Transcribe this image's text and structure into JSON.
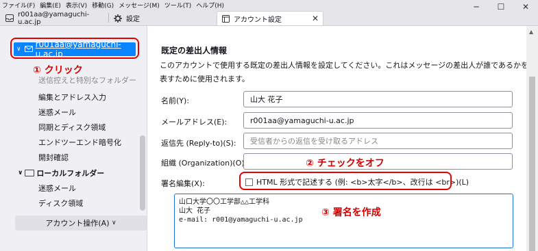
{
  "menu": [
    "ファイル(F)",
    "編集(E)",
    "表示(V)",
    "移動(G)",
    "メッセージ(M)",
    "ツール(T)",
    "ヘルプ(H)"
  ],
  "window_controls": {
    "minimize": "─",
    "maximize": "☐",
    "close": "✕"
  },
  "tabs": [
    {
      "label": "r001aa@yamaguchi-u.ac.jp",
      "icon": "inbox-icon"
    },
    {
      "label": "設定",
      "icon": "gear-icon"
    },
    {
      "label": "アカウント設定",
      "icon": "account-settings-icon",
      "active": true
    }
  ],
  "sidebar": {
    "account": "r001aa@yamaguchi-u.ac.jp",
    "items": [
      "送信控えと特別なフォルダー",
      "編集とアドレス入力",
      "迷惑メール",
      "同期とディスク領域",
      "エンドツーエンド暗号化",
      "開封確認"
    ],
    "local_folders": "ローカルフォルダー",
    "local_items": [
      "迷惑メール",
      "ディスク領域"
    ],
    "account_actions": "アカウント操作(A)"
  },
  "annotations": {
    "click": "① クリック",
    "uncheck": "② チェックをオフ",
    "signature": "③ 署名を作成"
  },
  "main": {
    "title": "既定の差出人情報",
    "description": "このアカウントで使用する既定の差出人情報を設定してください。これはメッセージの差出人が誰であるかを表すために使用されます。",
    "fields": [
      {
        "label": "名前(Y):",
        "value": "山大 花子",
        "placeholder": ""
      },
      {
        "label": "メールアドレス(E):",
        "value": "r001aa@yamaguchi-u.ac.jp",
        "placeholder": ""
      },
      {
        "label": "返信先 (Reply-to)(S):",
        "value": "",
        "placeholder": "受信者からの返信を受け取るアドレス"
      },
      {
        "label": "組織 (Organization)(O):",
        "value": "",
        "placeholder": ""
      }
    ],
    "signature_label": "署名編集(X):",
    "html_checkbox_label": "HTML 形式で記述する (例: <b>太字</b>、改行は <br>)(L)",
    "html_checked": false,
    "signature_lines": [
      "山口大学〇〇工学部△△工学科",
      "山大 花子",
      "e-mail: r001@yamaguchi-u.ac.jp"
    ]
  },
  "colors": {
    "selection": "#0a84ff",
    "annotation": "#e00000",
    "focus": "#1a6fd6"
  }
}
